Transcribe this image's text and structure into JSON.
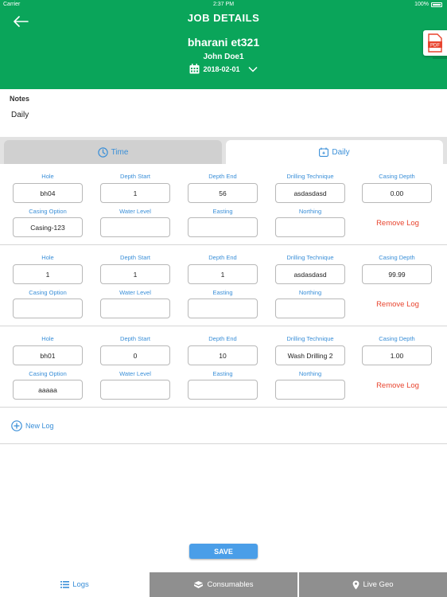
{
  "status_bar": {
    "carrier": "Carrier",
    "time": "2:37 PM",
    "battery": "100%"
  },
  "header": {
    "title": "JOB DETAILS",
    "job_name": "bharani et321",
    "customer": "John Doe1",
    "date": "2018-02-01",
    "pdf_label": "PDF"
  },
  "notes": {
    "label": "Notes",
    "value": "Daily"
  },
  "tabs": [
    {
      "label": "Time",
      "icon": "clock-icon",
      "active": false
    },
    {
      "label": "Daily",
      "icon": "calendar-icon",
      "active": true
    }
  ],
  "columns": {
    "row1": [
      "Hole",
      "Depth Start",
      "Depth End",
      "Drilling Technique",
      "Casing Depth"
    ],
    "row2": [
      "Casing Option",
      "Water Level",
      "Easting",
      "Northing"
    ]
  },
  "logs": [
    {
      "hole": "bh04",
      "depth_start": "1",
      "depth_end": "56",
      "drilling_technique": "asdasdasd",
      "casing_depth": "0.00",
      "casing_option": "Casing-123",
      "water_level": "",
      "easting": "",
      "northing": "",
      "remove_label": "Remove Log"
    },
    {
      "hole": "1",
      "depth_start": "1",
      "depth_end": "1",
      "drilling_technique": "asdasdasd",
      "casing_depth": "99.99",
      "casing_option": "",
      "water_level": "",
      "easting": "",
      "northing": "",
      "remove_label": "Remove Log"
    },
    {
      "hole": "bh01",
      "depth_start": "0",
      "depth_end": "10",
      "drilling_technique": "Wash Drilling 2",
      "casing_depth": "1.00",
      "casing_option": "aaaaa",
      "water_level": "",
      "easting": "",
      "northing": "",
      "remove_label": "Remove Log"
    }
  ],
  "new_log_label": "New Log",
  "save_label": "SAVE",
  "bottom_tabs": [
    {
      "label": "Logs",
      "icon": "list-icon",
      "active": true
    },
    {
      "label": "Consumables",
      "icon": "box-icon",
      "active": false
    },
    {
      "label": "Live Geo",
      "icon": "location-pin-icon",
      "active": false
    }
  ],
  "colors": {
    "header_green": "#0aa55a",
    "accent_blue": "#3a8fd8",
    "remove_red": "#e8442e",
    "save_blue": "#4a9ee8",
    "tab_gray": "#8f8f8f"
  }
}
